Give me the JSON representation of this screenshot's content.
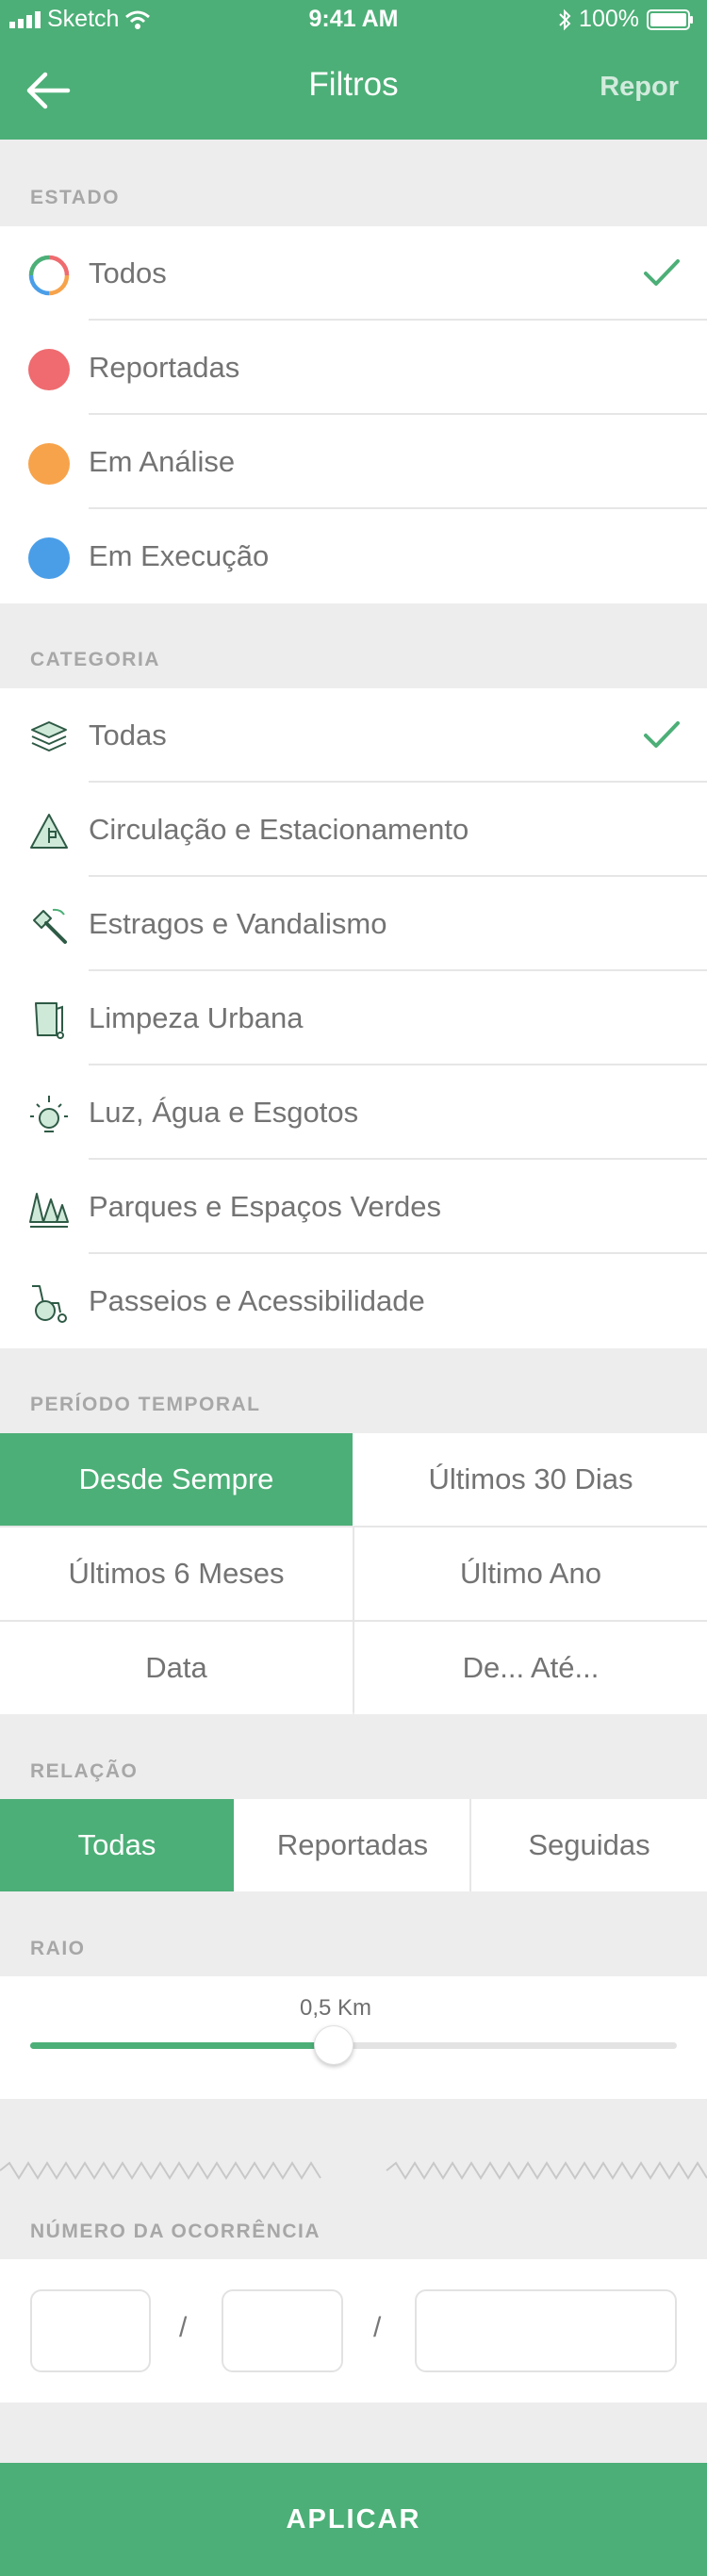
{
  "status_bar": {
    "carrier": "Sketch",
    "time": "9:41 AM",
    "battery": "100%"
  },
  "nav": {
    "title": "Filtros",
    "reset_label": "Repor"
  },
  "estado": {
    "section_label": "ESTADO",
    "selected": "Todos",
    "items": [
      {
        "label": "Todos",
        "icon": "ring-multicolor-icon",
        "color": "multicolor"
      },
      {
        "label": "Reportadas",
        "icon": "red-dot-icon",
        "color": "#ef6b6f"
      },
      {
        "label": "Em Análise",
        "icon": "orange-dot-icon",
        "color": "#f7a34b"
      },
      {
        "label": "Em Execução",
        "icon": "blue-dot-icon",
        "color": "#4a9ee8"
      }
    ]
  },
  "categoria": {
    "section_label": "CATEGORIA",
    "selected": "Todas",
    "items": [
      {
        "label": "Todas",
        "icon": "layers-icon"
      },
      {
        "label": "Circulação e Estacionamento",
        "icon": "traffic-sign-icon"
      },
      {
        "label": "Estragos e Vandalismo",
        "icon": "hammer-icon"
      },
      {
        "label": "Limpeza Urbana",
        "icon": "trash-bin-icon"
      },
      {
        "label": "Luz, Água e Esgotos",
        "icon": "light-bulb-icon"
      },
      {
        "label": "Parques e Espaços Verdes",
        "icon": "trees-icon"
      },
      {
        "label": "Passeios e Acessibilidade",
        "icon": "wheelchair-icon"
      }
    ]
  },
  "periodo": {
    "section_label": "PERÍODO TEMPORAL",
    "selected": "Desde Sempre",
    "options": [
      "Desde Sempre",
      "Últimos 30 Dias",
      "Últimos 6 Meses",
      "Último Ano",
      "Data",
      "De... Até..."
    ]
  },
  "relacao": {
    "section_label": "RELAÇÃO",
    "selected": "Todas",
    "options": [
      "Todas",
      "Reportadas",
      "Seguidas"
    ]
  },
  "raio": {
    "section_label": "RAIO",
    "value_label": "0,5 Km",
    "fraction": 0.47
  },
  "ocorrencia": {
    "section_label": "NÚMERO DA OCORRÊNCIA",
    "fields": [
      {
        "value": "",
        "placeholder": ""
      },
      {
        "value": "",
        "placeholder": ""
      },
      {
        "value": "",
        "placeholder": ""
      }
    ],
    "separator": "/"
  },
  "apply_label": "APLICAR",
  "colors": {
    "accent": "#4caf77",
    "background": "#ededed"
  }
}
